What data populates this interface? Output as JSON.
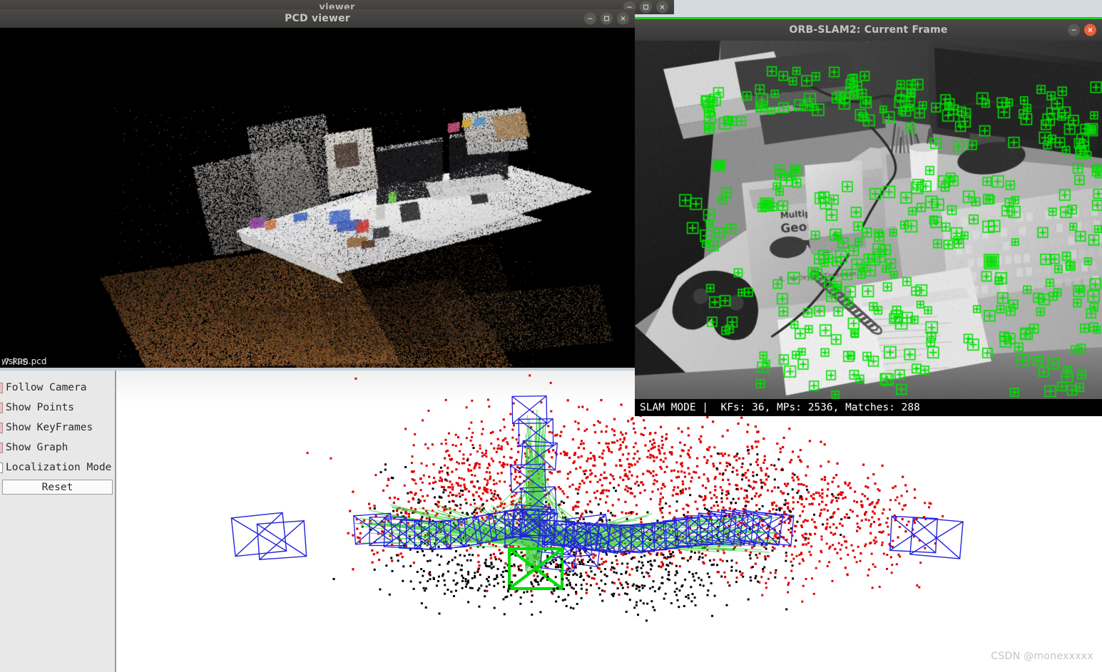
{
  "desktop": {
    "background_color": "#c9d0d6"
  },
  "background_window": {
    "title": "viewer",
    "controls": [
      {
        "name": "minimize",
        "glyph": "minus"
      },
      {
        "name": "maximize",
        "glyph": "square"
      },
      {
        "name": "close",
        "glyph": "cross"
      }
    ]
  },
  "pcd_viewer": {
    "title": "PCD viewer",
    "controls": [
      {
        "name": "minimize",
        "glyph": "minus"
      },
      {
        "name": "maximize",
        "glyph": "square"
      },
      {
        "name": "close",
        "glyph": "cross"
      }
    ],
    "overlay_fps": ".7 FPS",
    "overlay_filename": "wskun.pcd",
    "canvas_background": "#000000"
  },
  "control_panel": {
    "checkboxes": [
      {
        "label": "Follow Camera",
        "checked": true
      },
      {
        "label": "Show Points",
        "checked": true
      },
      {
        "label": "Show KeyFrames",
        "checked": true
      },
      {
        "label": "Show Graph",
        "checked": true
      },
      {
        "label": "Localization Mode",
        "checked": false
      }
    ],
    "reset_label": "Reset",
    "checked_color": "#f3bfc2",
    "panel_background": "#e8e8e8"
  },
  "map_viewer": {
    "background": "#ffffff",
    "colors": {
      "keyframe": "#2222dd",
      "current_camera": "#00dd00",
      "covisibility_graph": "#3fd13f",
      "map_point_recent": "#e00000",
      "map_point_old": "#000000"
    }
  },
  "orb_window": {
    "title": "ORB-SLAM2: Current Frame",
    "focus_accent": "#16d21a",
    "controls": [
      {
        "name": "minimize",
        "glyph": "minus"
      },
      {
        "name": "close",
        "glyph": "cross"
      }
    ],
    "status_text": "SLAM MODE |  KFs: 36, MPs: 2536, Matches: 288",
    "status": {
      "mode": "SLAM MODE",
      "keyframes": 36,
      "map_points": 2536,
      "matches": 288
    },
    "feature_color": "#00e000"
  },
  "watermark": {
    "text": "CSDN @monexxxxx"
  }
}
